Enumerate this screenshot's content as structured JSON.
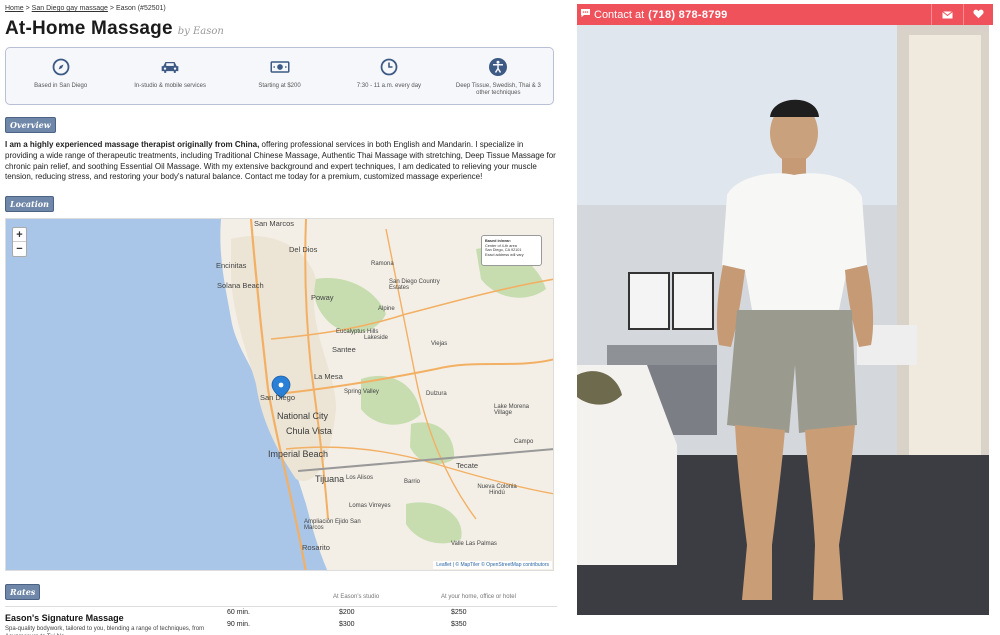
{
  "breadcrumb": {
    "home": "Home",
    "sep1": " > ",
    "category": "San Diego gay massage",
    "sep2": " > ",
    "current": "Eason (#52501)"
  },
  "profile": {
    "title": "At-Home Massage",
    "byline": "by Eason"
  },
  "facts": [
    {
      "icon": "compass-icon",
      "text": "Based in San Diego"
    },
    {
      "icon": "car-icon",
      "text": "In-studio & mobile services"
    },
    {
      "icon": "money-icon",
      "text": "Starting at $200"
    },
    {
      "icon": "clock-icon",
      "text": "7:30 - 11 a.m. every day"
    },
    {
      "icon": "accessibility-icon",
      "text": "Deep Tissue, Swedish, Thai & 3 other techniques"
    }
  ],
  "sections": {
    "overview": "Overview",
    "location": "Location",
    "rates": "Rates"
  },
  "overview": {
    "bold": "I am a highly experienced massage therapist originally from China,",
    "text": " offering professional services in both English and Mandarin. I specialize in providing a wide range of therapeutic treatments, including Traditional Chinese Massage, Authentic Thai Massage with stretching, Deep Tissue Massage for chronic pain relief, and soothing Essential Oil Massage. With my extensive background and expert techniques, I am dedicated to relieving your muscle tension, reducing stress, and restoring your body's natural balance. Contact me today for a premium, customized massage experience!"
  },
  "map": {
    "zoom_in": "+",
    "zoom_out": "−",
    "popup_lines": [
      "Based in/near:",
      "Center of 4-th area",
      "San Diego, CA 92101",
      "Exact address will vary"
    ],
    "attribution": "Leaflet | © MapTiler © OpenStreetMap contributors",
    "places": [
      "San Marcos",
      "Del Dios",
      "Encinitas",
      "Ramona",
      "San Diego Country Estates",
      "Solana Beach",
      "Poway",
      "Eucalyptus Hills",
      "Santee",
      "Alpine",
      "Viejas",
      "La Mesa",
      "Spring Valley",
      "San Diego",
      "National City",
      "Chula Vista",
      "Imperial Beach",
      "Tijuana",
      "Rosarito",
      "Lakeside",
      "Dulzura",
      "Lake Morena Village",
      "Tecate",
      "Nueva Colonia Hindú",
      "Valle Las Palmas",
      "Campo",
      "Los Alisos",
      "Lomas Virreyes",
      "Ampliación Ejido San Marcos",
      "Barrio"
    ],
    "colors": {
      "land": "#f3efe6",
      "water": "#a9c6e8",
      "green": "#c7ddb0",
      "urban": "#ece4d4",
      "road": "#f3b064",
      "border": "#999999",
      "pin": "#2a7fd6"
    }
  },
  "rates": {
    "col_studio": "At Eason's studio",
    "col_home": "At your home, office or hotel",
    "service_name": "Eason's Signature Massage",
    "service_desc": "Spa-quality bodywork, tailored to you, blending a range of techniques, from Acupressure to Tui Na.",
    "rows": [
      {
        "duration": "60 min.",
        "studio": "$200",
        "home": "$250"
      },
      {
        "duration": "90 min.",
        "studio": "$300",
        "home": "$350"
      }
    ]
  },
  "contact": {
    "label": "Contact at",
    "phone": "(718) 878-8799",
    "icons": [
      "chat-icon",
      "envelope-icon",
      "heart-icon"
    ],
    "color": "#f0525c"
  }
}
